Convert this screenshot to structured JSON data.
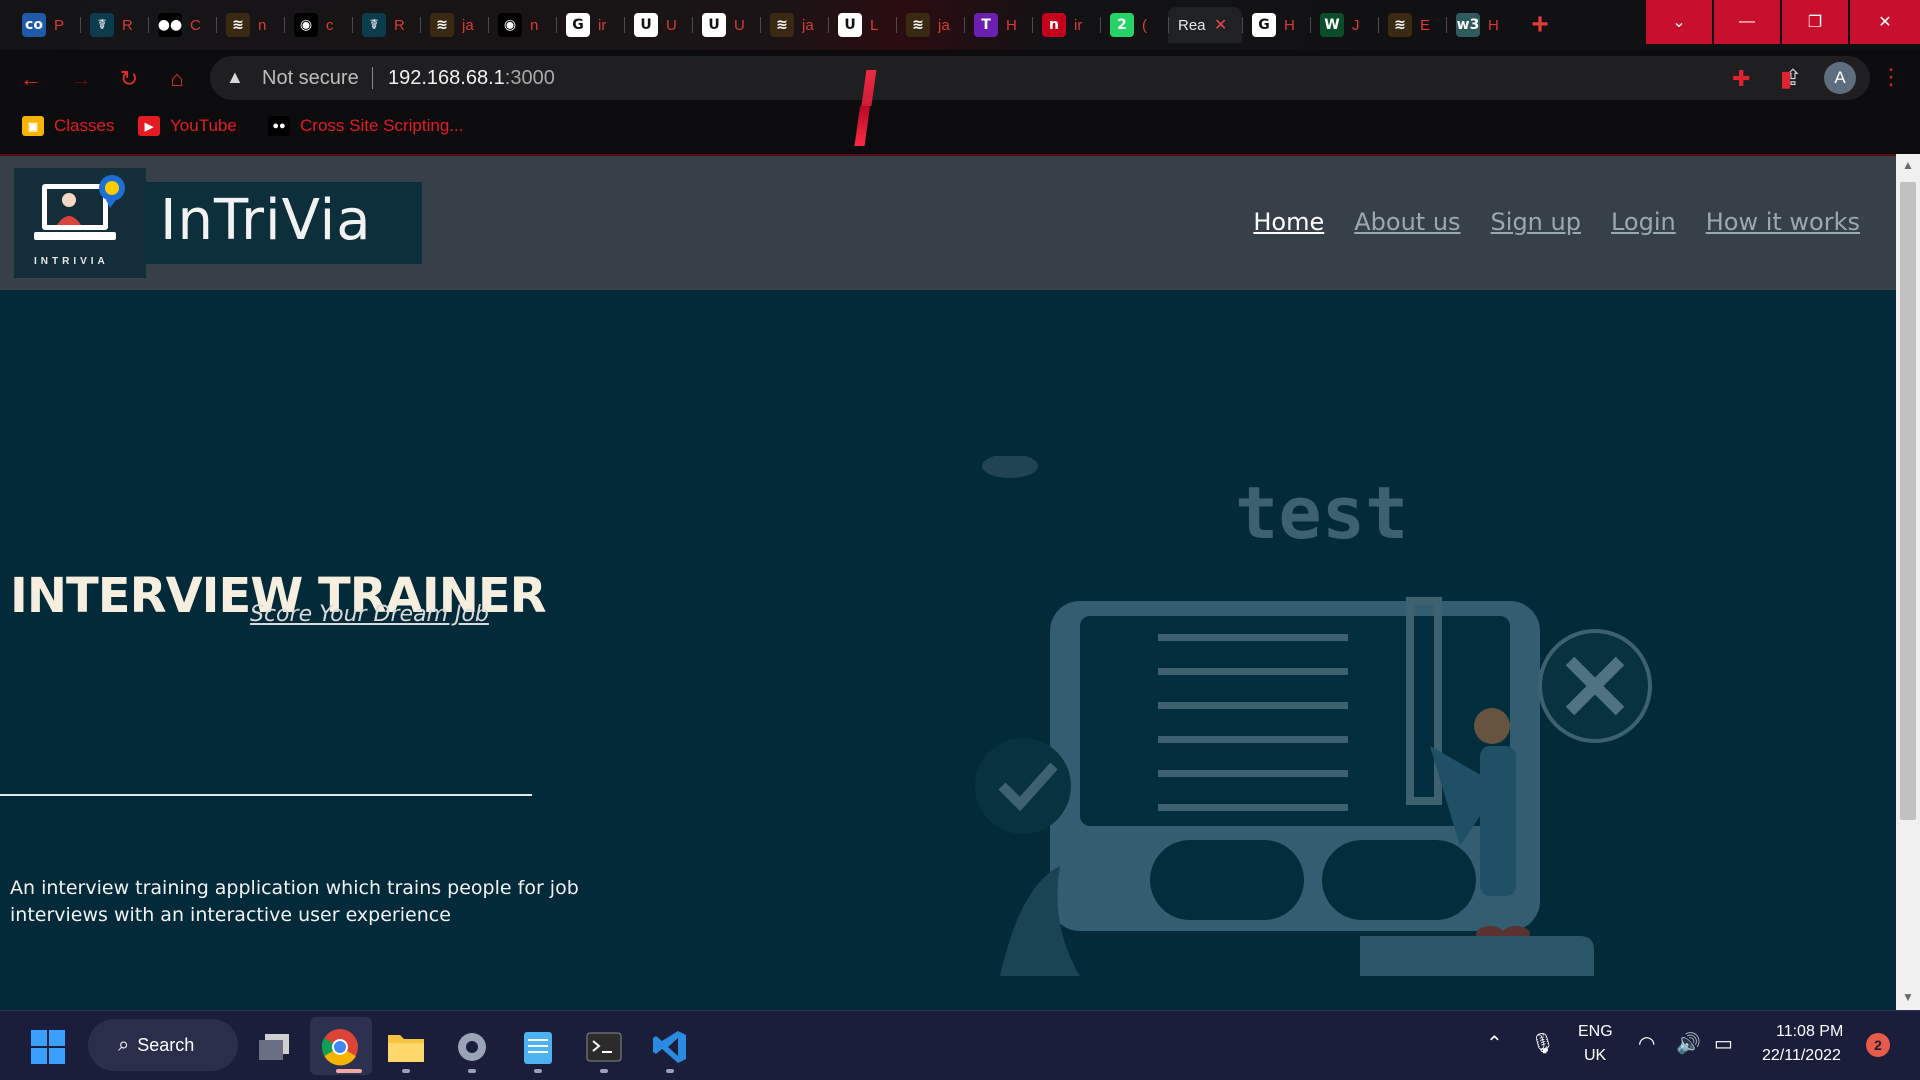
{
  "browser": {
    "tabs": [
      {
        "favicon": "co",
        "fav_color": "#1e5aa8",
        "title": "P"
      },
      {
        "favicon": "☤",
        "fav_color": "#0b3b4d",
        "title": "R"
      },
      {
        "favicon": "●●",
        "fav_color": "#000000",
        "title": "C"
      },
      {
        "favicon": "≋",
        "fav_color": "#3a2a14",
        "title": "n"
      },
      {
        "favicon": "◉",
        "fav_color": "#000000",
        "title": "c"
      },
      {
        "favicon": "☤",
        "fav_color": "#0b3b4d",
        "title": "R"
      },
      {
        "favicon": "≋",
        "fav_color": "#3a2a14",
        "title": "ja"
      },
      {
        "favicon": "◉",
        "fav_color": "#000000",
        "title": "n"
      },
      {
        "favicon": "G",
        "fav_color": "#ffffff",
        "title": "ir"
      },
      {
        "favicon": "U",
        "fav_color": "#ffffff",
        "title": "U"
      },
      {
        "favicon": "U",
        "fav_color": "#ffffff",
        "title": "U"
      },
      {
        "favicon": "≋",
        "fav_color": "#3a2a14",
        "title": "ja"
      },
      {
        "favicon": "U",
        "fav_color": "#ffffff",
        "title": "L"
      },
      {
        "favicon": "≋",
        "fav_color": "#3a2a14",
        "title": "ja"
      },
      {
        "favicon": "T",
        "fav_color": "#6b1fb1",
        "title": "H"
      },
      {
        "favicon": "n",
        "fav_color": "#c4001d",
        "title": "ir"
      },
      {
        "favicon": "2",
        "fav_color": "#25d366",
        "title": "("
      },
      {
        "favicon": "",
        "fav_color": "#202124",
        "title": "Rea"
      },
      {
        "favicon": "G",
        "fav_color": "#ffffff",
        "title": "H"
      },
      {
        "favicon": "W",
        "fav_color": "#0b4d2a",
        "title": "J"
      },
      {
        "favicon": "≋",
        "fav_color": "#3a2a14",
        "title": "E"
      },
      {
        "favicon": "w3",
        "fav_color": "#2f5a5e",
        "title": "H"
      }
    ],
    "new_tab": "+",
    "active_tab_index": 17,
    "address": {
      "security_label": "Not secure",
      "host": "192.168.68.1",
      "port": ":3000"
    },
    "profile_initial": "A",
    "bookmarks": [
      {
        "label": "Classes",
        "icon": "classroom-icon"
      },
      {
        "label": "YouTube",
        "icon": "youtube-icon"
      },
      {
        "label": "Cross Site Scripting...",
        "icon": "medium-icon"
      }
    ],
    "accent_color": "#e31c23"
  },
  "site": {
    "logo_text": "InTriVia",
    "logo_small": "INTRIVIA",
    "nav": [
      {
        "label": "Home",
        "current": true
      },
      {
        "label": "About us",
        "current": false
      },
      {
        "label": "Sign up",
        "current": false
      },
      {
        "label": "Login",
        "current": false
      },
      {
        "label": "How it works",
        "current": false
      }
    ],
    "hero": {
      "title": "INTERVIEW TRAINER",
      "subtitle": "Score Your Dream Job",
      "illustration_text": "test",
      "description": "An interview training application which trains people for job interviews with an interactive user experience"
    },
    "colors": {
      "background": "#022a38",
      "header": "#374048"
    }
  },
  "taskbar": {
    "search_label": "Search",
    "language": "ENG",
    "region": "UK",
    "time": "11:08 PM",
    "date": "22/11/2022",
    "notifications": "2"
  }
}
